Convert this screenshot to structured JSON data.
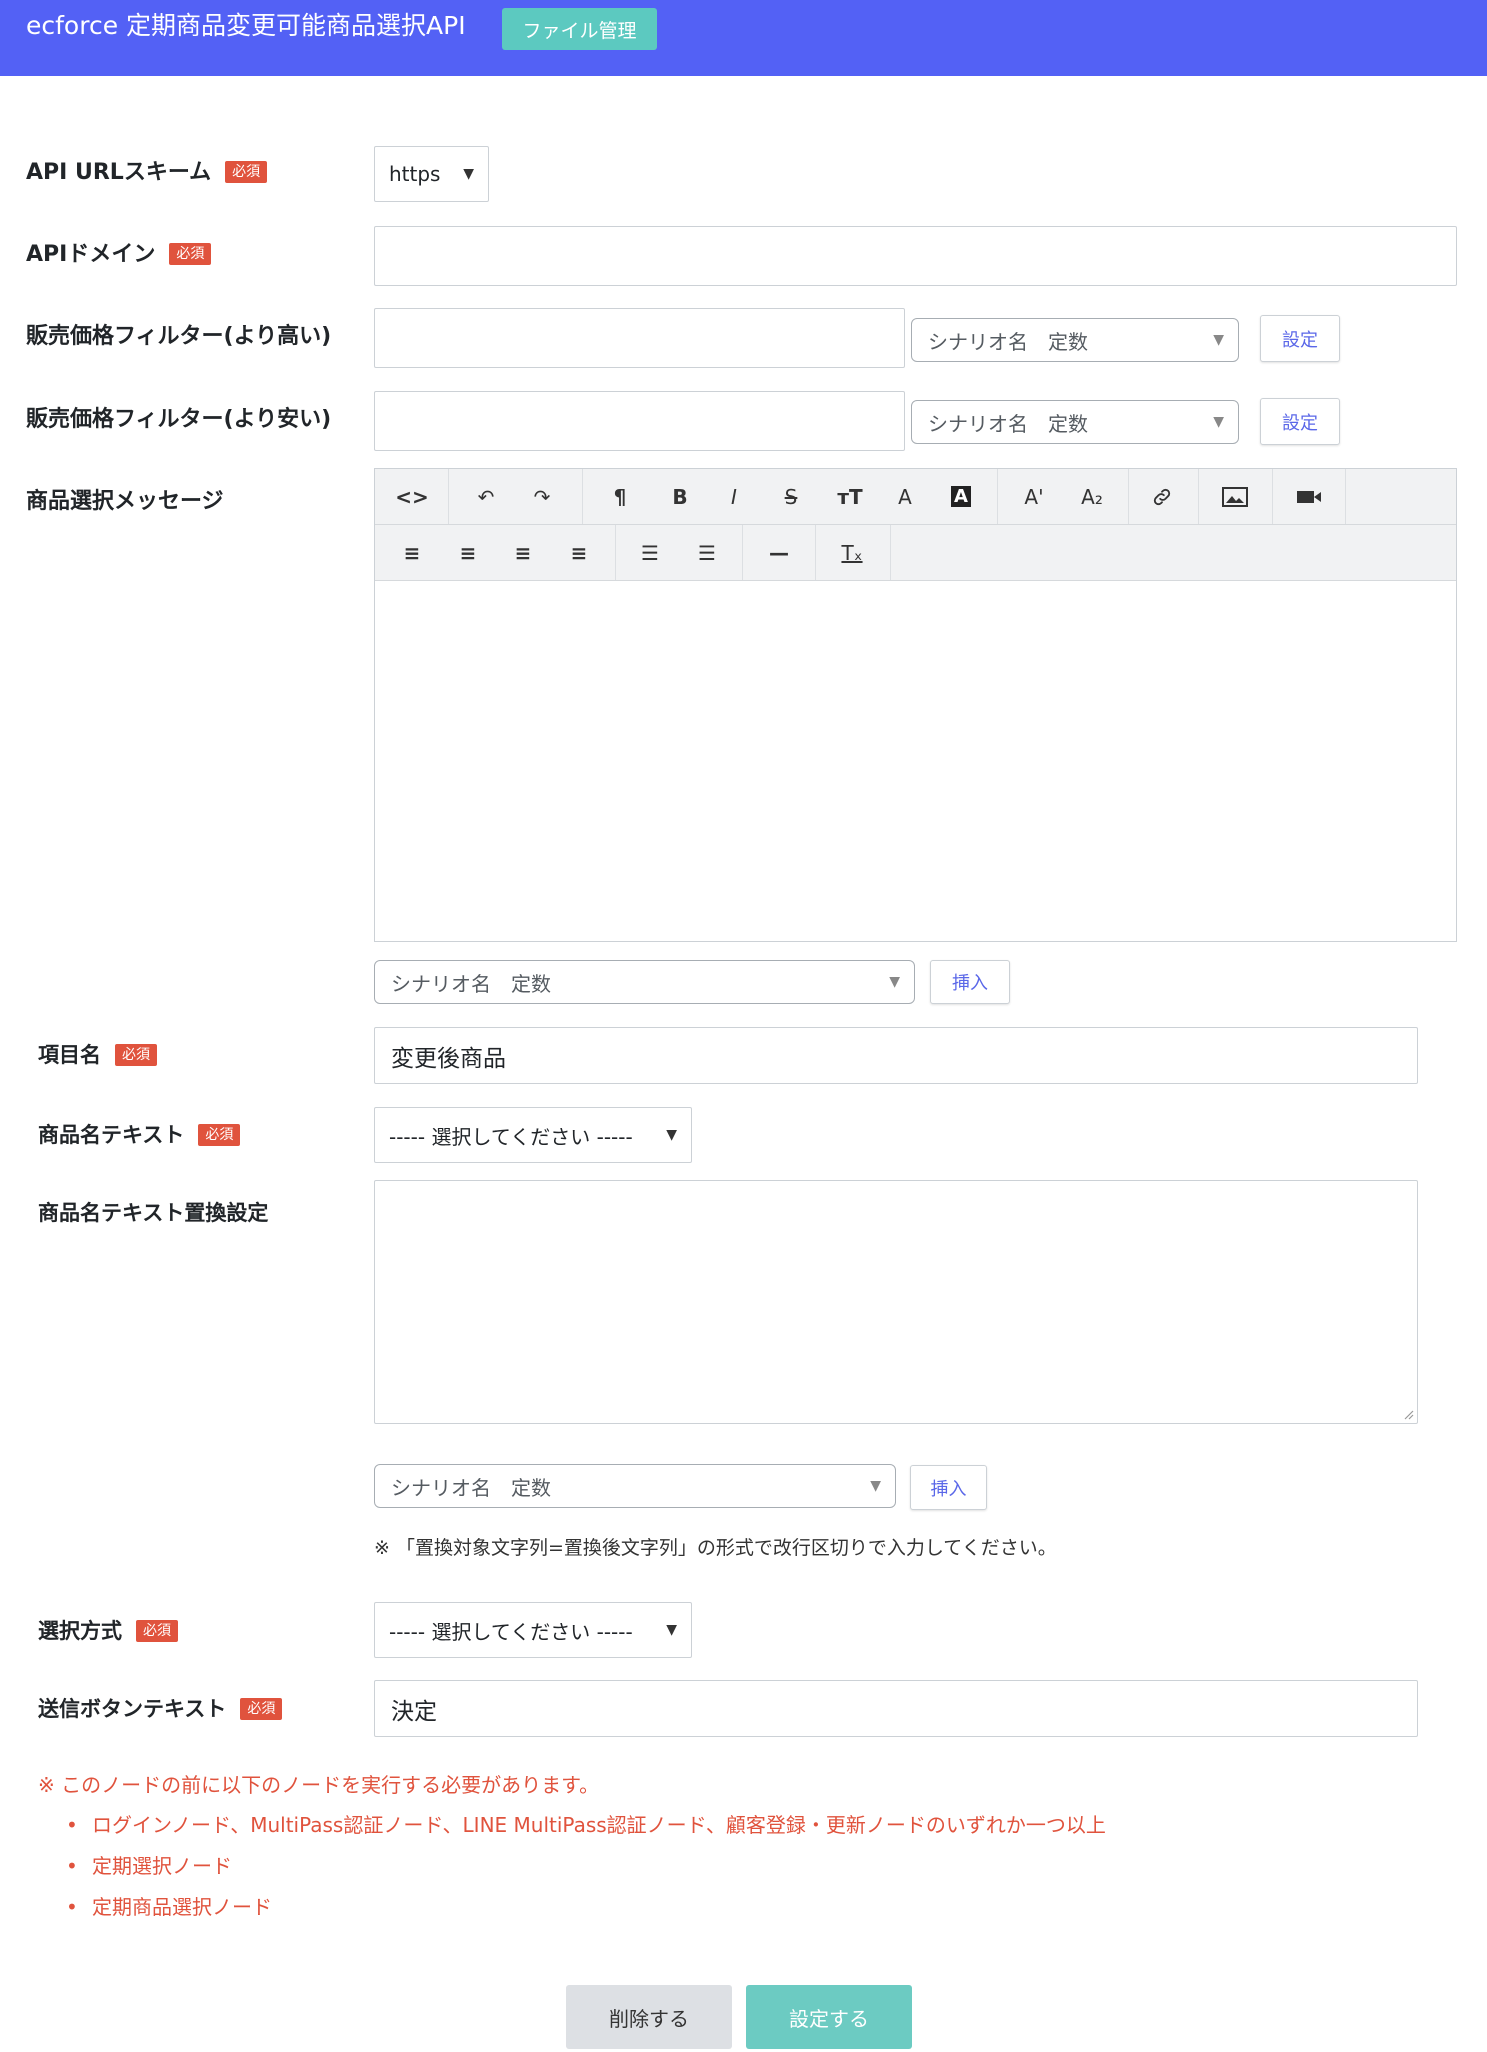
{
  "header": {
    "title": "ecforce 定期商品変更可能商品選択API",
    "file_button": "ファイル管理"
  },
  "required_badge": "必須",
  "scheme": {
    "label": "API URLスキーム",
    "value": "https"
  },
  "domain_field": {
    "label": "APIドメイン",
    "value": ""
  },
  "price_high": {
    "label": "販売価格フィルター(より高い)",
    "value": "",
    "scenario_select": "シナリオ名　定数",
    "set_button": "設定"
  },
  "price_low": {
    "label": "販売価格フィルター(より安い)",
    "value": "",
    "scenario_select": "シナリオ名　定数",
    "set_button": "設定"
  },
  "message": {
    "label": "商品選択メッセージ",
    "scenario_select": "シナリオ名　定数",
    "insert_button": "挿入",
    "toolbar": {
      "row1": [
        {
          "name": "code-view-icon",
          "glyph": "<>"
        },
        {
          "name": "undo-icon",
          "glyph": "↶"
        },
        {
          "name": "redo-icon",
          "glyph": "↷"
        },
        {
          "name": "paragraph-icon",
          "glyph": "¶"
        },
        {
          "name": "bold-icon",
          "glyph": "B"
        },
        {
          "name": "italic-icon",
          "glyph": "I"
        },
        {
          "name": "strikethrough-icon",
          "glyph": "S"
        },
        {
          "name": "font-size-icon",
          "glyph": "тT"
        },
        {
          "name": "font-color-icon",
          "glyph": "A"
        },
        {
          "name": "background-color-icon",
          "glyph": "A"
        },
        {
          "name": "superscript-icon",
          "glyph": "A'"
        },
        {
          "name": "subscript-icon",
          "glyph": "A₂"
        },
        {
          "name": "link-icon",
          "glyph": "🔗"
        },
        {
          "name": "image-icon",
          "glyph": "▨"
        },
        {
          "name": "video-icon",
          "glyph": "■"
        }
      ],
      "row2": [
        {
          "name": "align-left-icon",
          "glyph": "≡"
        },
        {
          "name": "align-center-icon",
          "glyph": "≡"
        },
        {
          "name": "align-right-icon",
          "glyph": "≡"
        },
        {
          "name": "align-justify-icon",
          "glyph": "≡"
        },
        {
          "name": "bullet-list-icon",
          "glyph": "☰"
        },
        {
          "name": "numbered-list-icon",
          "glyph": "☰"
        },
        {
          "name": "horizontal-rule-icon",
          "glyph": "—"
        },
        {
          "name": "clear-format-icon",
          "glyph": "Tₓ"
        }
      ]
    }
  },
  "item_name": {
    "label": "項目名",
    "value": "変更後商品"
  },
  "product_text": {
    "label": "商品名テキスト",
    "value": "----- 選択してください -----"
  },
  "replace_setting": {
    "label": "商品名テキスト置換設定",
    "scenario_select": "シナリオ名　定数",
    "insert_button": "挿入",
    "note": "※ 「置換対象文字列=置換後文字列」の形式で改行区切りで入力してください。"
  },
  "selection_method": {
    "label": "選択方式",
    "value": "----- 選択してください -----"
  },
  "submit_text": {
    "label": "送信ボタンテキスト",
    "value": "決定"
  },
  "warning": {
    "title": "※ このノードの前に以下のノードを実行する必要があります。",
    "items": [
      "ログインノード、MultiPass認証ノード、LINE MultiPass認証ノード、顧客登録・更新ノードのいずれか一つ以上",
      "定期選択ノード",
      "定期商品選択ノード"
    ]
  },
  "footer": {
    "delete_button": "削除する",
    "submit_button": "設定する"
  },
  "colors": {
    "header": "#5361f5",
    "accent": "#5cc9c0",
    "required": "#e0533d",
    "link": "#5a67e8"
  }
}
